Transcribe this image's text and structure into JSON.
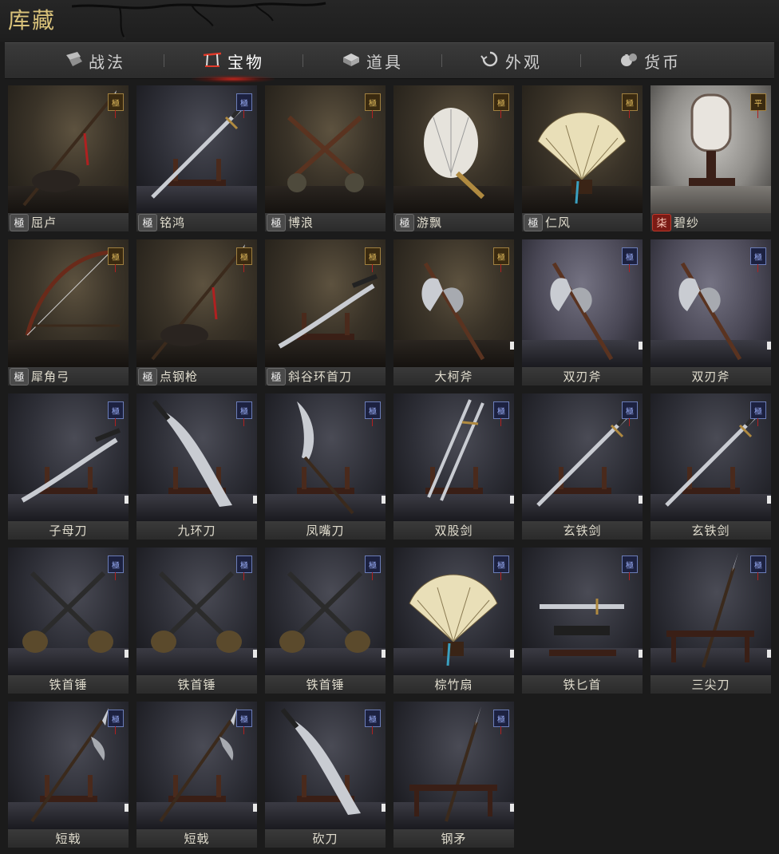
{
  "header": {
    "title": "库藏"
  },
  "tabs": [
    {
      "label": "战法",
      "icon": "scroll-icon",
      "active": false
    },
    {
      "label": "宝物",
      "icon": "shrine-icon",
      "active": true
    },
    {
      "label": "道具",
      "icon": "box-icon",
      "active": false
    },
    {
      "label": "外观",
      "icon": "swirl-icon",
      "active": false
    },
    {
      "label": "货币",
      "icon": "coin-bag-icon",
      "active": false
    }
  ],
  "items": [
    {
      "name": "屈卢",
      "badge": "極",
      "badge_style": "grey",
      "bg": "warm",
      "art": "spear",
      "tier": "極"
    },
    {
      "name": "铭鸿",
      "badge": "極",
      "badge_style": "grey",
      "bg": "cool",
      "art": "sword",
      "tier": "極"
    },
    {
      "name": "博浪",
      "badge": "極",
      "badge_style": "grey",
      "bg": "warm",
      "art": "cross",
      "tier": "極"
    },
    {
      "name": "游飘",
      "badge": "極",
      "badge_style": "grey",
      "bg": "warm",
      "art": "featherfan",
      "tier": "極"
    },
    {
      "name": "仁风",
      "badge": "極",
      "badge_style": "grey",
      "bg": "warm",
      "art": "fan",
      "tier": "極"
    },
    {
      "name": "碧纱",
      "badge": "柒",
      "badge_style": "red",
      "bg": "pale",
      "art": "screen",
      "tier": "平"
    },
    {
      "name": "犀角弓",
      "badge": "極",
      "badge_style": "grey",
      "bg": "warm",
      "art": "bow",
      "tier": "極"
    },
    {
      "name": "点钢枪",
      "badge": "極",
      "badge_style": "grey",
      "bg": "warm",
      "art": "spear",
      "tier": "極"
    },
    {
      "name": "斜谷环首刀",
      "badge": "極",
      "badge_style": "grey",
      "bg": "warm",
      "art": "saber",
      "tier": "極"
    },
    {
      "name": "大柯斧",
      "badge": "",
      "badge_style": "none",
      "bg": "warm",
      "art": "axe",
      "tier": "極"
    },
    {
      "name": "双刃斧",
      "badge": "",
      "badge_style": "none",
      "bg": "grey",
      "art": "axe",
      "tier": "極"
    },
    {
      "name": "双刃斧",
      "badge": "",
      "badge_style": "none",
      "bg": "grey",
      "art": "axe",
      "tier": "極"
    },
    {
      "name": "子母刀",
      "badge": "",
      "badge_style": "none",
      "bg": "cool",
      "art": "saber",
      "tier": "極"
    },
    {
      "name": "九环刀",
      "badge": "",
      "badge_style": "none",
      "bg": "cool",
      "art": "broadblade",
      "tier": "極"
    },
    {
      "name": "凤嘴刀",
      "badge": "",
      "badge_style": "none",
      "bg": "cool",
      "art": "glaive",
      "tier": "極"
    },
    {
      "name": "双股剑",
      "badge": "",
      "badge_style": "none",
      "bg": "cool",
      "art": "twinswords",
      "tier": "極"
    },
    {
      "name": "玄铁剑",
      "badge": "",
      "badge_style": "none",
      "bg": "cool",
      "art": "sword",
      "tier": "極"
    },
    {
      "name": "玄铁剑",
      "badge": "",
      "badge_style": "none",
      "bg": "cool",
      "art": "sword",
      "tier": "極"
    },
    {
      "name": "铁首锤",
      "badge": "",
      "badge_style": "none",
      "bg": "cool",
      "art": "hammers",
      "tier": "極"
    },
    {
      "name": "铁首锤",
      "badge": "",
      "badge_style": "none",
      "bg": "cool",
      "art": "hammers",
      "tier": "極"
    },
    {
      "name": "铁首锤",
      "badge": "",
      "badge_style": "none",
      "bg": "cool",
      "art": "hammers",
      "tier": "極"
    },
    {
      "name": "棕竹扇",
      "badge": "",
      "badge_style": "none",
      "bg": "cool",
      "art": "fan",
      "tier": "極"
    },
    {
      "name": "铁匕首",
      "badge": "",
      "badge_style": "none",
      "bg": "cool",
      "art": "dagger",
      "tier": "極"
    },
    {
      "name": "三尖刀",
      "badge": "",
      "badge_style": "none",
      "bg": "cool",
      "art": "polearm",
      "tier": "極"
    },
    {
      "name": "短戟",
      "badge": "",
      "badge_style": "none",
      "bg": "cool",
      "art": "halberd",
      "tier": "極"
    },
    {
      "name": "短戟",
      "badge": "",
      "badge_style": "none",
      "bg": "cool",
      "art": "halberd",
      "tier": "極"
    },
    {
      "name": "砍刀",
      "badge": "",
      "badge_style": "none",
      "bg": "cool",
      "art": "broadblade",
      "tier": "極"
    },
    {
      "name": "钢矛",
      "badge": "",
      "badge_style": "none",
      "bg": "cool",
      "art": "polearm",
      "tier": "極"
    }
  ]
}
